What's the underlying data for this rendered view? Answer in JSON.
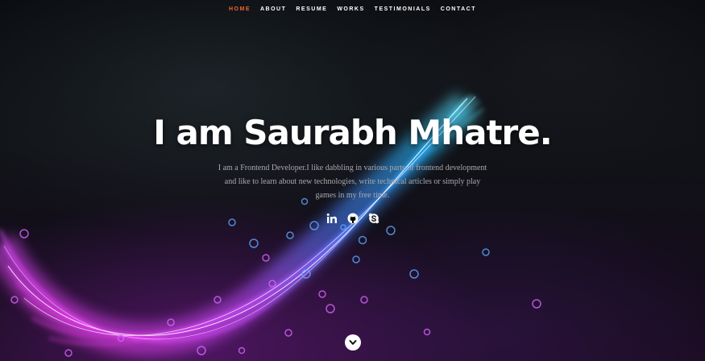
{
  "nav": {
    "items": [
      {
        "label": "HOME",
        "active": true
      },
      {
        "label": "ABOUT",
        "active": false
      },
      {
        "label": "RESUME",
        "active": false
      },
      {
        "label": "WORKS",
        "active": false
      },
      {
        "label": "TESTIMONIALS",
        "active": false
      },
      {
        "label": "CONTACT",
        "active": false
      }
    ],
    "active_color": "#f0642d"
  },
  "hero": {
    "headline": "I am Saurabh Mhatre.",
    "intro": "I am a Frontend Developer.I like dabbling in various parts of frontend development and like to learn about new technologies, write technical articles or simply play games in my free time.",
    "social": [
      {
        "icon": "linkedin-icon"
      },
      {
        "icon": "github-icon"
      },
      {
        "icon": "skype-icon"
      }
    ],
    "scroll_icon": "chevron-down-icon"
  }
}
